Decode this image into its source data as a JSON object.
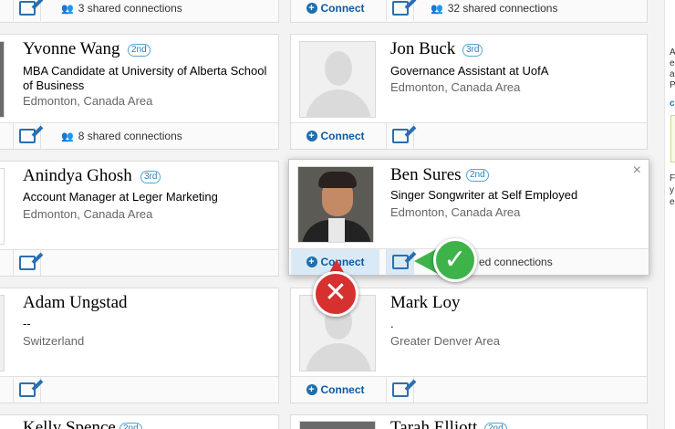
{
  "cards": [
    {
      "id": "top-left",
      "name": "",
      "badge": "",
      "headline": "",
      "location": "",
      "connect": "",
      "shared": "3 shared connections"
    },
    {
      "id": "top-right",
      "name": "",
      "badge": "",
      "headline": "",
      "location": "",
      "connect": "Connect",
      "shared": "32 shared connections"
    },
    {
      "id": "yvonne",
      "name": "Yvonne Wang",
      "badge": "2nd",
      "headline": "MBA Candidate at University of Alberta School of Business",
      "location": "Edmonton, Canada Area",
      "connect": "",
      "shared": "8 shared connections"
    },
    {
      "id": "jon",
      "name": "Jon Buck",
      "badge": "3rd",
      "headline": "Governance Assistant at UofA",
      "location": "Edmonton, Canada Area",
      "connect": "Connect",
      "shared": ""
    },
    {
      "id": "anindya",
      "name": "Anindya Ghosh",
      "badge": "3rd",
      "headline": "Account Manager at Leger Marketing",
      "location": "Edmonton, Canada Area",
      "connect": "",
      "shared": ""
    },
    {
      "id": "ben",
      "name": "Ben Sures",
      "badge": "2nd",
      "headline": "Singer Songwriter at Self Employed",
      "location": "Edmonton, Canada Area",
      "connect": "Connect",
      "shared": "ed connections",
      "close": "×"
    },
    {
      "id": "adam",
      "name": "Adam Ungstad",
      "badge": "",
      "headline": "--",
      "location": "Switzerland",
      "connect": "",
      "shared": ""
    },
    {
      "id": "mark",
      "name": "Mark Loy",
      "badge": "",
      "headline": ".",
      "location": "Greater Denver Area",
      "connect": "Connect",
      "shared": ""
    },
    {
      "id": "kelly",
      "name": "Kelly Spence",
      "badge": "2nd",
      "headline": "",
      "location": "",
      "connect": "",
      "shared": ""
    },
    {
      "id": "tarah",
      "name": "Tarah Elliott",
      "badge": "2nd",
      "headline": "",
      "location": "",
      "connect": "",
      "shared": ""
    }
  ],
  "overlays": {
    "ok": "✓",
    "no": "✕"
  },
  "sidebar": {
    "lines": [
      "A",
      "e",
      "a",
      "P"
    ],
    "link": "c",
    "lower": [
      "F",
      "y",
      "e"
    ]
  }
}
